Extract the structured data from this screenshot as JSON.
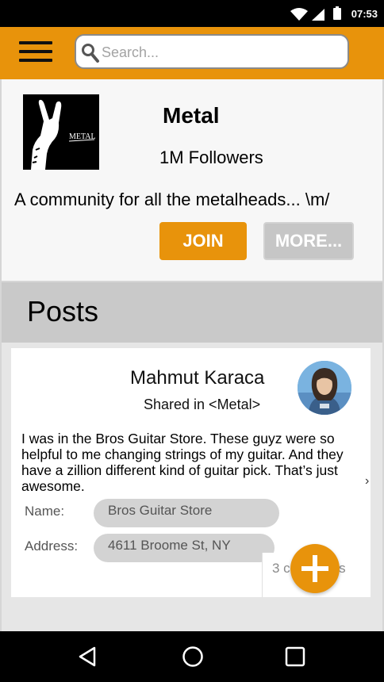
{
  "status_bar": {
    "time": "07:53"
  },
  "search": {
    "placeholder": "Search..."
  },
  "community": {
    "image_caption": "METAL",
    "title": "Metal",
    "followers": "1M Followers",
    "description": "A community for all the metalheads... \\m/",
    "join_label": "JOIN",
    "more_label": "MORE..."
  },
  "posts": {
    "heading": "Posts",
    "items": [
      {
        "author": "Mahmut Karaca",
        "shared_in": "Shared in <Metal>",
        "text": "I was in the Bros Guitar Store. These guyz were so helpful to me changing strings of my guitar. And they have a zillion different kind of guitar pick. That’s just awesome.",
        "name_label": "Name:",
        "name_value": "Bros Guitar Store",
        "address_label": "Address:",
        "address_value": "4611 Broome St, NY",
        "comments": "3 comments"
      }
    ]
  },
  "stray_mark": "›",
  "colors": {
    "accent": "#e8930b",
    "card": "#ffffff",
    "section": "#c9c9c9"
  },
  "icons": {
    "menu": "menu-icon",
    "search": "search-icon",
    "fab": "plus-icon",
    "nav": [
      "back-icon",
      "home-icon",
      "recent-apps-icon"
    ]
  }
}
